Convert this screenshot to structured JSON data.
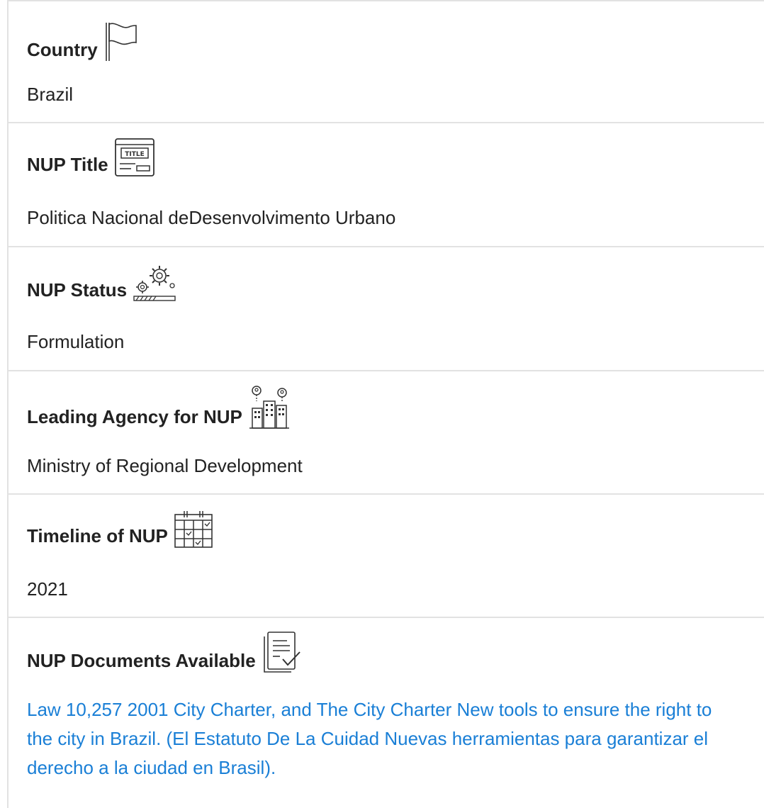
{
  "fields": [
    {
      "label": "Country",
      "value": "Brazil",
      "icon": "flag-icon"
    },
    {
      "label": "NUP Title",
      "value": "Politica Nacional deDesenvolvimento Urbano",
      "icon": "title-icon"
    },
    {
      "label": "NUP Status",
      "value": "Formulation",
      "icon": "gears-progress-icon"
    },
    {
      "label": "Leading Agency for NUP",
      "value": "Ministry of Regional Development",
      "icon": "agency-buildings-icon"
    },
    {
      "label": "Timeline of NUP",
      "value": "2021",
      "icon": "calendar-icon"
    },
    {
      "label": "NUP Documents Available",
      "value": "Law 10,257 2001 City Charter, and The City Charter New tools to ensure the right to the city in Brazil. (El Estatuto De La Cuidad Nuevas herramientas para garantizar el derecho a la ciudad en Brasil).",
      "icon": "document-check-icon"
    }
  ],
  "colors": {
    "link": "#1a7fd6",
    "border": "#e2e2e2",
    "text": "#222222"
  }
}
